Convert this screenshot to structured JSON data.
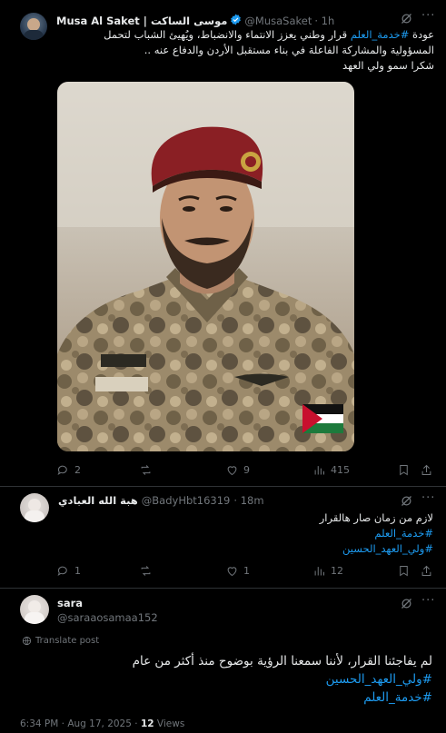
{
  "colors": {
    "accent": "#1d9bf0",
    "muted": "#71767b",
    "background": "#000000",
    "divider": "#2f3336",
    "verified": "#1d9bf0"
  },
  "main_post": {
    "display_name": "Musa Al Saket | موسى الساكت",
    "handle": "@MusaSaket",
    "time": "· 1h",
    "text_prefix": "عودة",
    "hashtag": "#خدمة_العلم",
    "text_line1_rest": "قرار وطني يعزز الانتماء والانضباط، ويُهيئ الشباب لتحمل",
    "text_line2": "المسؤولية والمشاركة الفاعلة في بناء مستقبل الأردن والدفاع عنه ..",
    "text_line3": "شكرا سمو ولي العهد",
    "image_icon": "photo-soldier-portrait",
    "replies": "2",
    "reposts": "",
    "likes": "9",
    "views": "415"
  },
  "reply1": {
    "display_name": "هبة الله العبادي",
    "handle": "@BadyHbt16319",
    "time": "· 18m",
    "text": "لازم من زمان صار هالقرار",
    "hashtag1": "#خدمة_العلم",
    "hashtag2": "#ولي_العهد_الحسين",
    "replies": "1",
    "reposts": "",
    "likes": "1",
    "views": "12"
  },
  "reply2": {
    "display_name": "sara",
    "handle": "@saraaosamaa152",
    "translate": "Translate post",
    "text": "لم يفاجئنا القرار، لأننا سمعنا الرؤية بوضوح منذ أكثر من عام",
    "hashtag1": "#ولي_العهد_الحسين",
    "hashtag2": "#خدمة_العلم",
    "timestamp": "6:34 PM · Aug 17, 2025 ·",
    "views_count": "12",
    "views_label": "Views"
  },
  "icons": [
    "grok-icon",
    "more-icon",
    "reply-icon",
    "repost-icon",
    "like-icon",
    "views-icon",
    "bookmark-icon",
    "share-icon",
    "verified-icon",
    "globe-icon"
  ]
}
